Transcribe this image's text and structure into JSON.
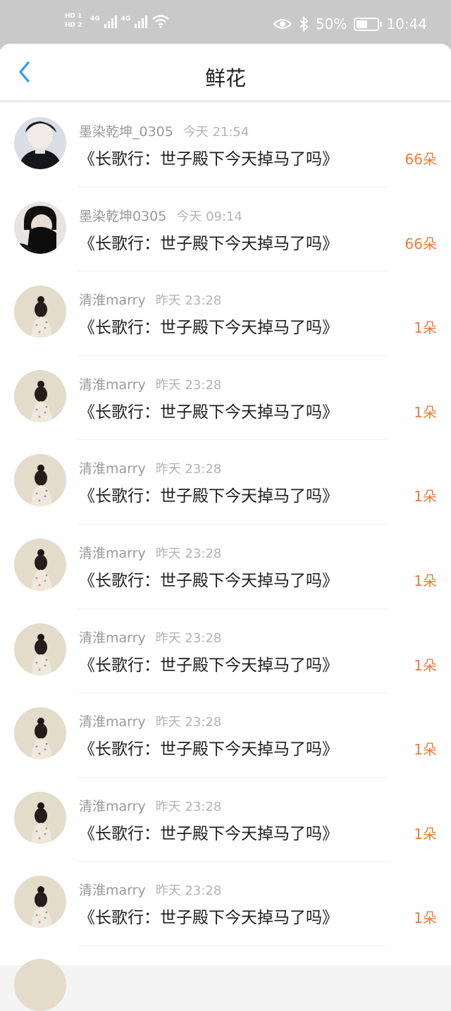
{
  "status_bar": {
    "sim_tags": [
      "HD 1",
      "HD 2"
    ],
    "network": [
      "4G",
      "4G"
    ],
    "battery_percent": "50%",
    "time": "10:44",
    "icons": [
      "eye-icon",
      "bluetooth-icon",
      "battery-icon",
      "wifi-icon",
      "signal-icon"
    ]
  },
  "header": {
    "title": "鲜花",
    "back_icon": "chevron-left-icon",
    "accent_color": "#2a9df4"
  },
  "colors": {
    "count": "#f07a3a"
  },
  "list": [
    {
      "user": "墨染乾坤_0305",
      "time": "今天 21:54",
      "book": "《长歌行：世子殿下今天掉马了吗》",
      "count": "66朵",
      "avatar": "dark-portrait-1"
    },
    {
      "user": "墨染乾坤0305",
      "time": "今天 09:14",
      "book": "《长歌行：世子殿下今天掉马了吗》",
      "count": "66朵",
      "avatar": "dark-portrait-2"
    },
    {
      "user": "清淮marry",
      "time": "昨天 23:28",
      "book": "《长歌行：世子殿下今天掉马了吗》",
      "count": "1朵",
      "avatar": "beige-figure"
    },
    {
      "user": "清淮marry",
      "time": "昨天 23:28",
      "book": "《长歌行：世子殿下今天掉马了吗》",
      "count": "1朵",
      "avatar": "beige-figure"
    },
    {
      "user": "清淮marry",
      "time": "昨天 23:28",
      "book": "《长歌行：世子殿下今天掉马了吗》",
      "count": "1朵",
      "avatar": "beige-figure"
    },
    {
      "user": "清淮marry",
      "time": "昨天 23:28",
      "book": "《长歌行：世子殿下今天掉马了吗》",
      "count": "1朵",
      "avatar": "beige-figure"
    },
    {
      "user": "清淮marry",
      "time": "昨天 23:28",
      "book": "《长歌行：世子殿下今天掉马了吗》",
      "count": "1朵",
      "avatar": "beige-figure"
    },
    {
      "user": "清淮marry",
      "time": "昨天 23:28",
      "book": "《长歌行：世子殿下今天掉马了吗》",
      "count": "1朵",
      "avatar": "beige-figure"
    },
    {
      "user": "清淮marry",
      "time": "昨天 23:28",
      "book": "《长歌行：世子殿下今天掉马了吗》",
      "count": "1朵",
      "avatar": "beige-figure"
    },
    {
      "user": "清淮marry",
      "time": "昨天 23:28",
      "book": "《长歌行：世子殿下今天掉马了吗》",
      "count": "1朵",
      "avatar": "beige-figure"
    }
  ]
}
